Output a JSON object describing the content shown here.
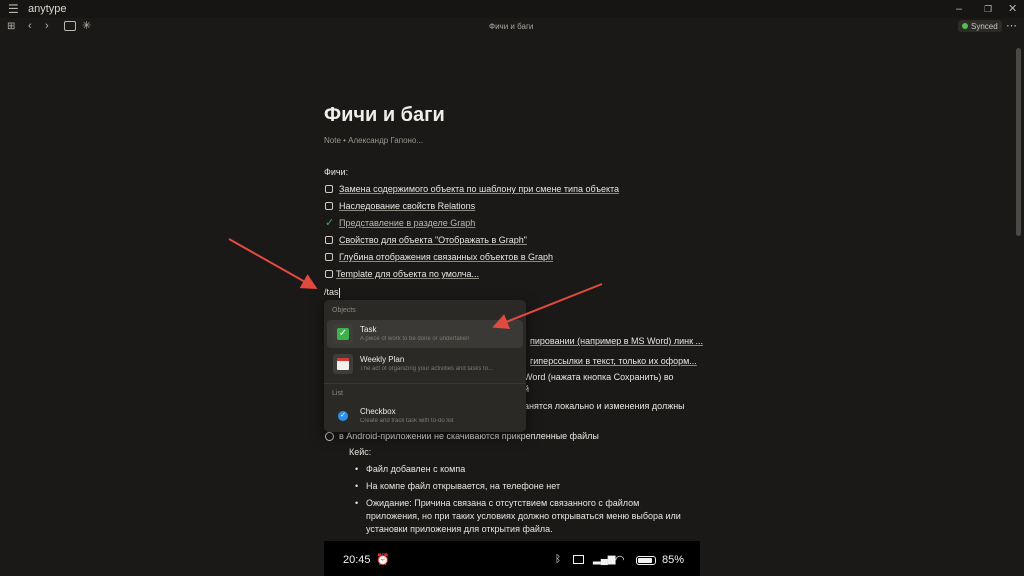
{
  "app": {
    "name": "anytype"
  },
  "header": {
    "title": "Фичи и баги",
    "sync_status": "Synced"
  },
  "document": {
    "title": "Фичи и баги",
    "meta_type": "Note",
    "meta_author": "Александр Гапоно...",
    "section_label": "Фичи:",
    "checklist": [
      {
        "label": "Замена содержимого объекта по шаблону при смене типа объекта",
        "done": false
      },
      {
        "label": "Наследование свойств Relations",
        "done": false
      },
      {
        "label": "Представление в разделе Graph",
        "done": true
      },
      {
        "label": "Свойство для объекта \"Отображать в Graph\"",
        "done": false
      },
      {
        "label": "Глубина отображения связанных объектов в Graph",
        "done": false
      },
      {
        "label": "Template для объекта по умолча...",
        "done": false
      }
    ],
    "input_text": "/tas",
    "hidden_rows": [
      "пировании (например в MS Word) линк ...",
      "гиперссылки в текст, только их оформ...",
      "Word (нажата кнопка Сохранить) во",
      "й",
      "анятся локально и изменения должны"
    ],
    "bug_item": "в Android-приложении не скачиваются прикрепленные файлы",
    "case_label": "Кейс:",
    "bullets": [
      "Файл добавлен с компа",
      "На компе файл открывается, на телефоне нет",
      "Ожидание: Причина связана с отсутствием связанного с файлом",
      "приложения, но при таких условиях должно открываться меню выбора или",
      "установки приложения для открытия файла."
    ]
  },
  "slash_menu": {
    "objects_heading": "Objects",
    "list_heading": "List",
    "items": [
      {
        "name": "Task",
        "description": "A piece of work to be done or undertaken",
        "icon": "task-check-icon"
      },
      {
        "name": "Weekly Plan",
        "description": "The act of organizing your activities and tasks fo...",
        "icon": "calendar-icon"
      },
      {
        "name": "Checkbox",
        "description": "Create and track task with to-do list",
        "icon": "checkbox-circle-icon"
      }
    ]
  },
  "phone_screenshot": {
    "time": "20:45",
    "battery": "85%"
  },
  "colors": {
    "background": "#1a1917",
    "accent_green": "#2ebd3b",
    "annotation_arrow": "#e24a3f",
    "menu_bg": "#2a2926"
  }
}
